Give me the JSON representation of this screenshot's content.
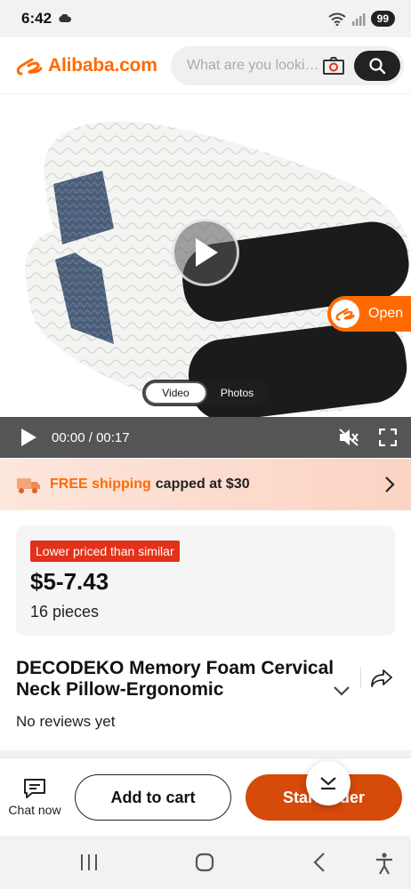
{
  "status_bar": {
    "time": "6:42",
    "battery": "99"
  },
  "header": {
    "logo_text": "Alibaba.com",
    "search_placeholder": "What are you looking for?"
  },
  "media": {
    "open_label": "Open",
    "toggle": [
      {
        "label": "Video",
        "active": true
      },
      {
        "label": "Photos",
        "active": false
      }
    ],
    "time_current": "00:00",
    "time_separator": "/",
    "time_total": "00:17"
  },
  "shipping": {
    "highlight": "FREE shipping",
    "rest": "capped at $30"
  },
  "price_card": {
    "badge": "Lower priced than similar",
    "price": "$5-7.43",
    "pieces": "16 pieces"
  },
  "product": {
    "title": "DECODEKO Memory Foam Cervical Neck Pillow-Ergonomic",
    "reviews": "No reviews yet"
  },
  "actions": {
    "chat_label": "Chat now",
    "add_to_cart": "Add to cart",
    "start_order": "Start order"
  },
  "colors": {
    "brand": "#ff6a00",
    "order_button": "#d64a0a",
    "badge": "#e3321a"
  }
}
